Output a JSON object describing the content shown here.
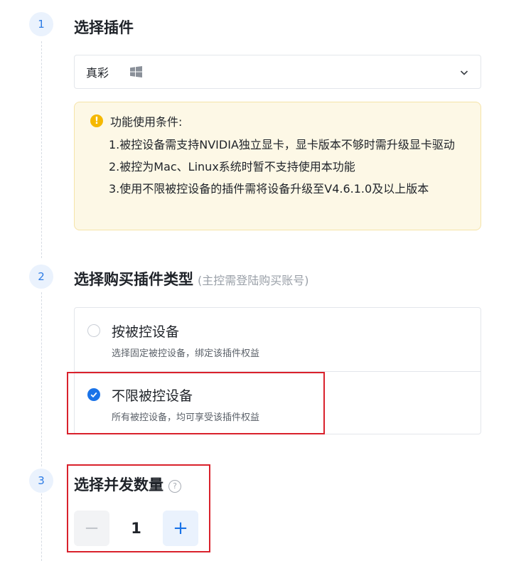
{
  "steps": [
    {
      "number": "1",
      "title": "选择插件"
    },
    {
      "number": "2",
      "title": "选择购买插件类型",
      "hint": "(主控需登陆购买账号)"
    },
    {
      "number": "3",
      "title": "选择并发数量"
    }
  ],
  "plugin_select": {
    "value": "真彩",
    "platform_icon": "windows-icon"
  },
  "notice": {
    "title": "功能使用条件:",
    "lines": [
      "1.被控设备需支持NVIDIA独立显卡，显卡版本不够时需升级显卡驱动",
      "2.被控为Mac、Linux系统时暂不支持使用本功能",
      "3.使用不限被控设备的插件需将设备升级至V4.6.1.0及以上版本"
    ]
  },
  "purchase_options": [
    {
      "title": "按被控设备",
      "desc": "选择固定被控设备，绑定该插件权益",
      "selected": false
    },
    {
      "title": "不限被控设备",
      "desc": "所有被控设备，均可享受该插件权益",
      "selected": true
    }
  ],
  "quantity": {
    "value": "1",
    "minus_label": "−",
    "plus_label": "+",
    "help_label": "?"
  },
  "colors": {
    "accent": "#1a73e8",
    "highlight_box": "#d9212c",
    "notice_bg": "#fdf8e6",
    "warning": "#f5b800"
  }
}
